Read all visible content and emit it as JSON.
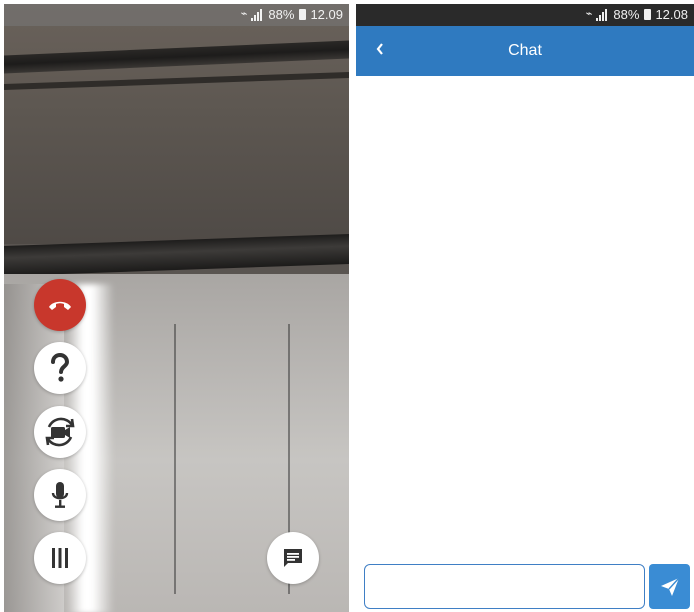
{
  "left_status": {
    "battery": "88%",
    "time": "12.09"
  },
  "right_status": {
    "battery": "88%",
    "time": "12.08"
  },
  "call": {
    "controls": [
      {
        "id": "end-call",
        "icon": "phone-hangup-icon"
      },
      {
        "id": "help",
        "icon": "question-mark-icon"
      },
      {
        "id": "switch-camera",
        "icon": "camera-switch-icon"
      },
      {
        "id": "microphone",
        "icon": "microphone-icon"
      },
      {
        "id": "menu",
        "icon": "menu-bars-icon"
      }
    ],
    "chat_fab_icon": "chat-bubble-icon",
    "colors": {
      "end_call": "#c8372c",
      "button": "#ffffff"
    }
  },
  "chat": {
    "title": "Chat",
    "back_icon": "chevron-left-icon",
    "input": {
      "value": "",
      "placeholder": ""
    },
    "send_icon": "paper-plane-icon",
    "colors": {
      "header": "#2f7ac0",
      "send": "#3a8cd4",
      "input_border": "#3f7fc5"
    }
  }
}
